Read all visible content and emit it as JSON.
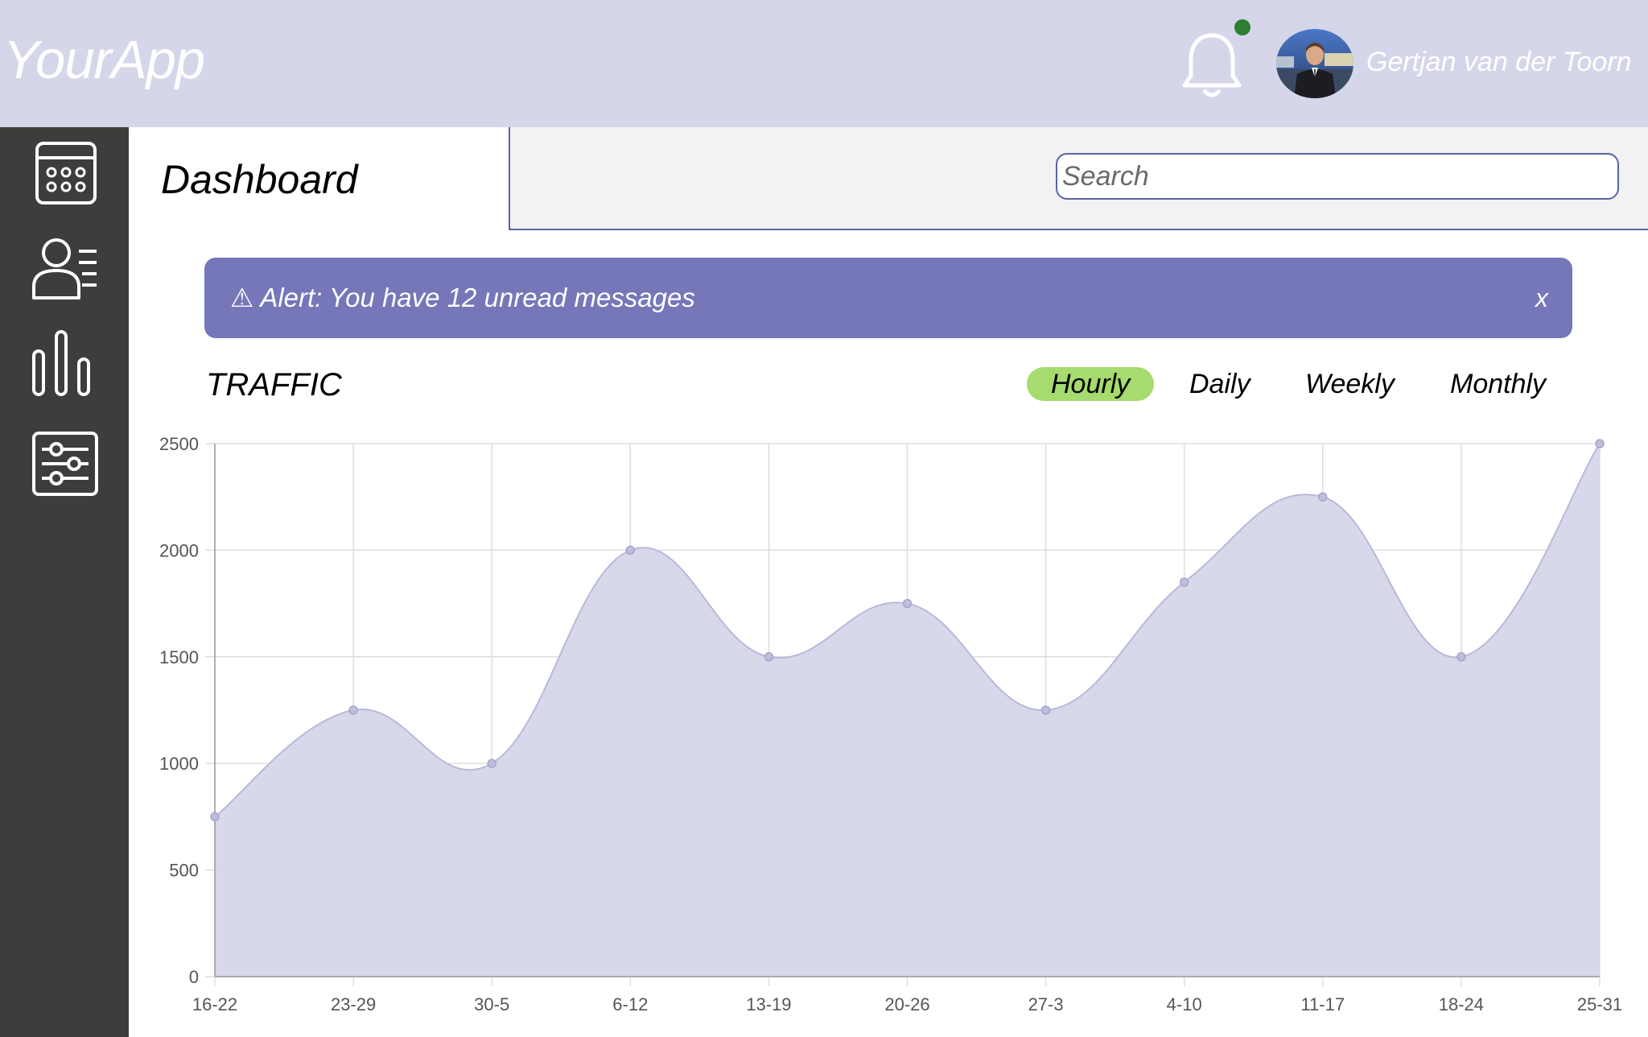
{
  "header": {
    "logo": "YourApp",
    "user_name": "Gertjan van der Toorn",
    "avatar_alt": "user avatar"
  },
  "sidebar": {
    "items": [
      {
        "icon": "calendar-icon"
      },
      {
        "icon": "users-icon"
      },
      {
        "icon": "bar-chart-icon"
      },
      {
        "icon": "settings-sliders-icon"
      }
    ]
  },
  "page": {
    "title": "Dashboard"
  },
  "search": {
    "placeholder": "Search"
  },
  "alert": {
    "text": "⚠ Alert: You have 12 unread messages",
    "close": "x"
  },
  "traffic": {
    "title": "TRAFFIC",
    "tabs": [
      "Hourly",
      "Daily",
      "Weekly",
      "Monthly"
    ],
    "active_tab": "Hourly"
  },
  "colors": {
    "header_bg": "#d6d6ea",
    "sidebar_bg": "#3d3d3b",
    "alert_bg": "#7577b9",
    "active_tab": "#a6db6e",
    "chart_fill": "#d6d6ea",
    "notification_dot": "#2e7d32"
  },
  "chart_data": {
    "type": "area",
    "categories": [
      "16-22",
      "23-29",
      "30-5",
      "6-12",
      "13-19",
      "20-26",
      "27-3",
      "4-10",
      "11-17",
      "18-24",
      "25-31"
    ],
    "values": [
      750,
      1250,
      1000,
      2000,
      1500,
      1750,
      1250,
      1850,
      2250,
      1500,
      2500
    ],
    "yticks": [
      0,
      500,
      1000,
      1500,
      2000,
      2500
    ],
    "ylim": [
      0,
      2500
    ],
    "grid": true,
    "legend": "none"
  }
}
